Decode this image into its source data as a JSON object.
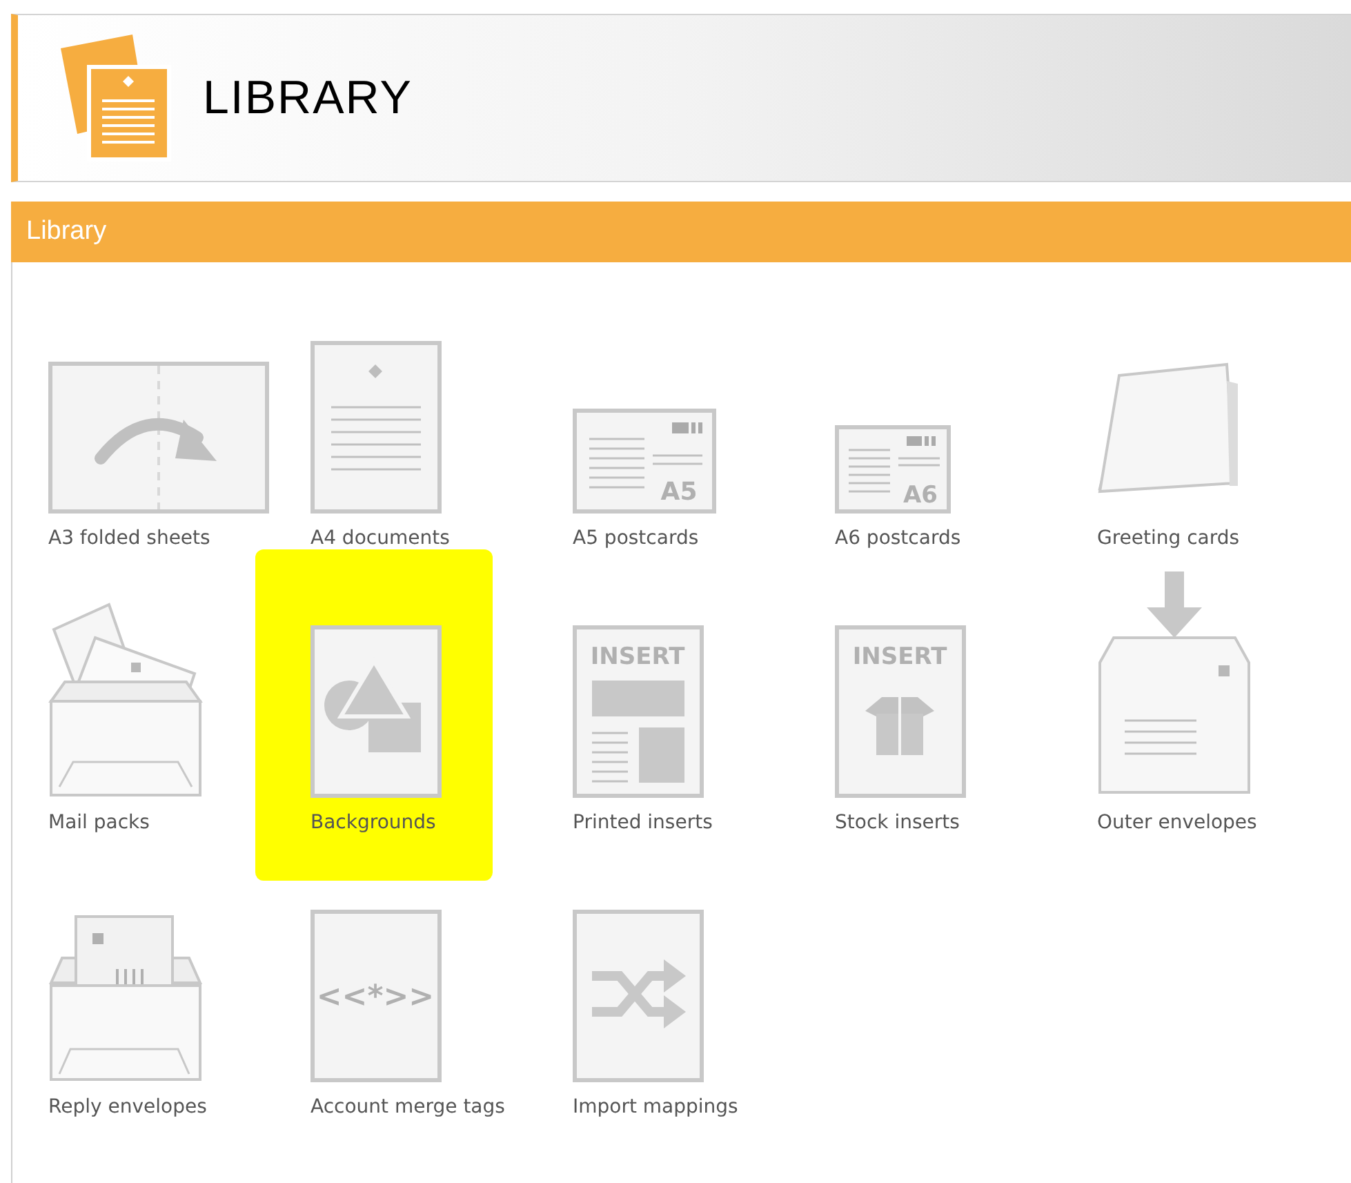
{
  "header": {
    "title": "LIBRARY"
  },
  "section": {
    "title": "Library"
  },
  "items": [
    {
      "kind": "a3",
      "label": "A3 folded sheets",
      "highlighted": false
    },
    {
      "kind": "a4",
      "label": "A4 documents",
      "highlighted": false
    },
    {
      "kind": "postcard_large",
      "label": "A5 postcards",
      "icon_text": "A5",
      "highlighted": false
    },
    {
      "kind": "postcard_small",
      "label": "A6 postcards",
      "icon_text": "A6",
      "highlighted": false
    },
    {
      "kind": "greeting",
      "label": "Greeting cards",
      "highlighted": false
    },
    {
      "kind": "mailpack",
      "label": "Mail packs",
      "highlighted": false
    },
    {
      "kind": "shapes",
      "label": "Backgrounds",
      "highlighted": true
    },
    {
      "kind": "printed_insert",
      "label": "Printed inserts",
      "icon_text": "INSERT",
      "highlighted": false
    },
    {
      "kind": "stock_insert",
      "label": "Stock inserts",
      "icon_text": "INSERT",
      "highlighted": false
    },
    {
      "kind": "outer_envelope",
      "label": "Outer envelopes",
      "highlighted": false
    },
    {
      "kind": "reply_envelope",
      "label": "Reply envelopes",
      "highlighted": false
    },
    {
      "kind": "merge",
      "label": "Account merge tags",
      "icon_text": "<<*>>",
      "highlighted": false
    },
    {
      "kind": "shuffle",
      "label": "Import mappings",
      "highlighted": false
    }
  ]
}
